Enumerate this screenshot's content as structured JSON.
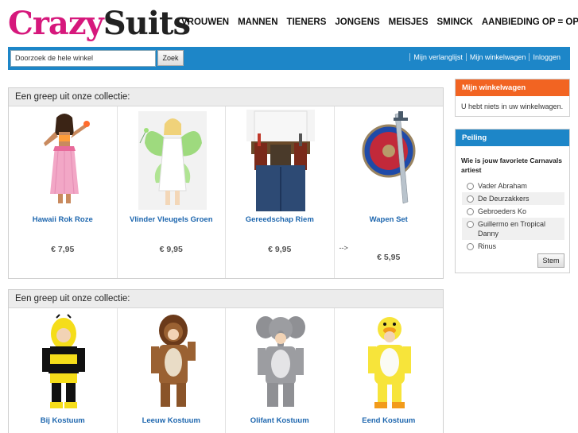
{
  "logo": {
    "part1": "Crazy",
    "part2": "Suits"
  },
  "nav": [
    "VROUWEN",
    "MANNEN",
    "TIENERS",
    "JONGENS",
    "MEISJES",
    "SMINCK",
    "AANBIEDING OP = OP"
  ],
  "search": {
    "placeholder": "Doorzoek de hele winkel",
    "button": "Zoek"
  },
  "toplinks": [
    "Mijn verlanglijst",
    "Mijn winkelwagen",
    "Inloggen"
  ],
  "collections": [
    {
      "title": "Een greep uit onze collectie:",
      "products": [
        {
          "name": "Hawaii Rok Roze",
          "price": "€ 7,95"
        },
        {
          "name": "Vlinder Vleugels Groen",
          "price": "€ 9,95"
        },
        {
          "name": "Gereedschap Riem",
          "price": "€ 9,95"
        },
        {
          "name": "Wapen Set",
          "price": "€ 5,95",
          "prefix": "-->"
        }
      ]
    },
    {
      "title": "Een greep uit onze collectie:",
      "products": [
        {
          "name": "Bij Kostuum"
        },
        {
          "name": "Leeuw Kostuum"
        },
        {
          "name": "Olifant Kostuum"
        },
        {
          "name": "Eend Kostuum"
        }
      ]
    }
  ],
  "cart": {
    "title": "Mijn winkelwagen",
    "empty_text": "U hebt niets in uw winkelwagen."
  },
  "poll": {
    "title": "Peiling",
    "question": "Wie is jouw favoriete Carnavals artiest",
    "options": [
      "Vader Abraham",
      "De Deurzakkers",
      "Gebroeders Ko",
      "Guillermo en Tropical Danny",
      "Rinus"
    ],
    "button": "Stem"
  },
  "colors": {
    "brand_pink": "#d6187c",
    "bar_blue": "#1d86c8",
    "cart_orange": "#f26422",
    "link_blue": "#1d66ae"
  }
}
